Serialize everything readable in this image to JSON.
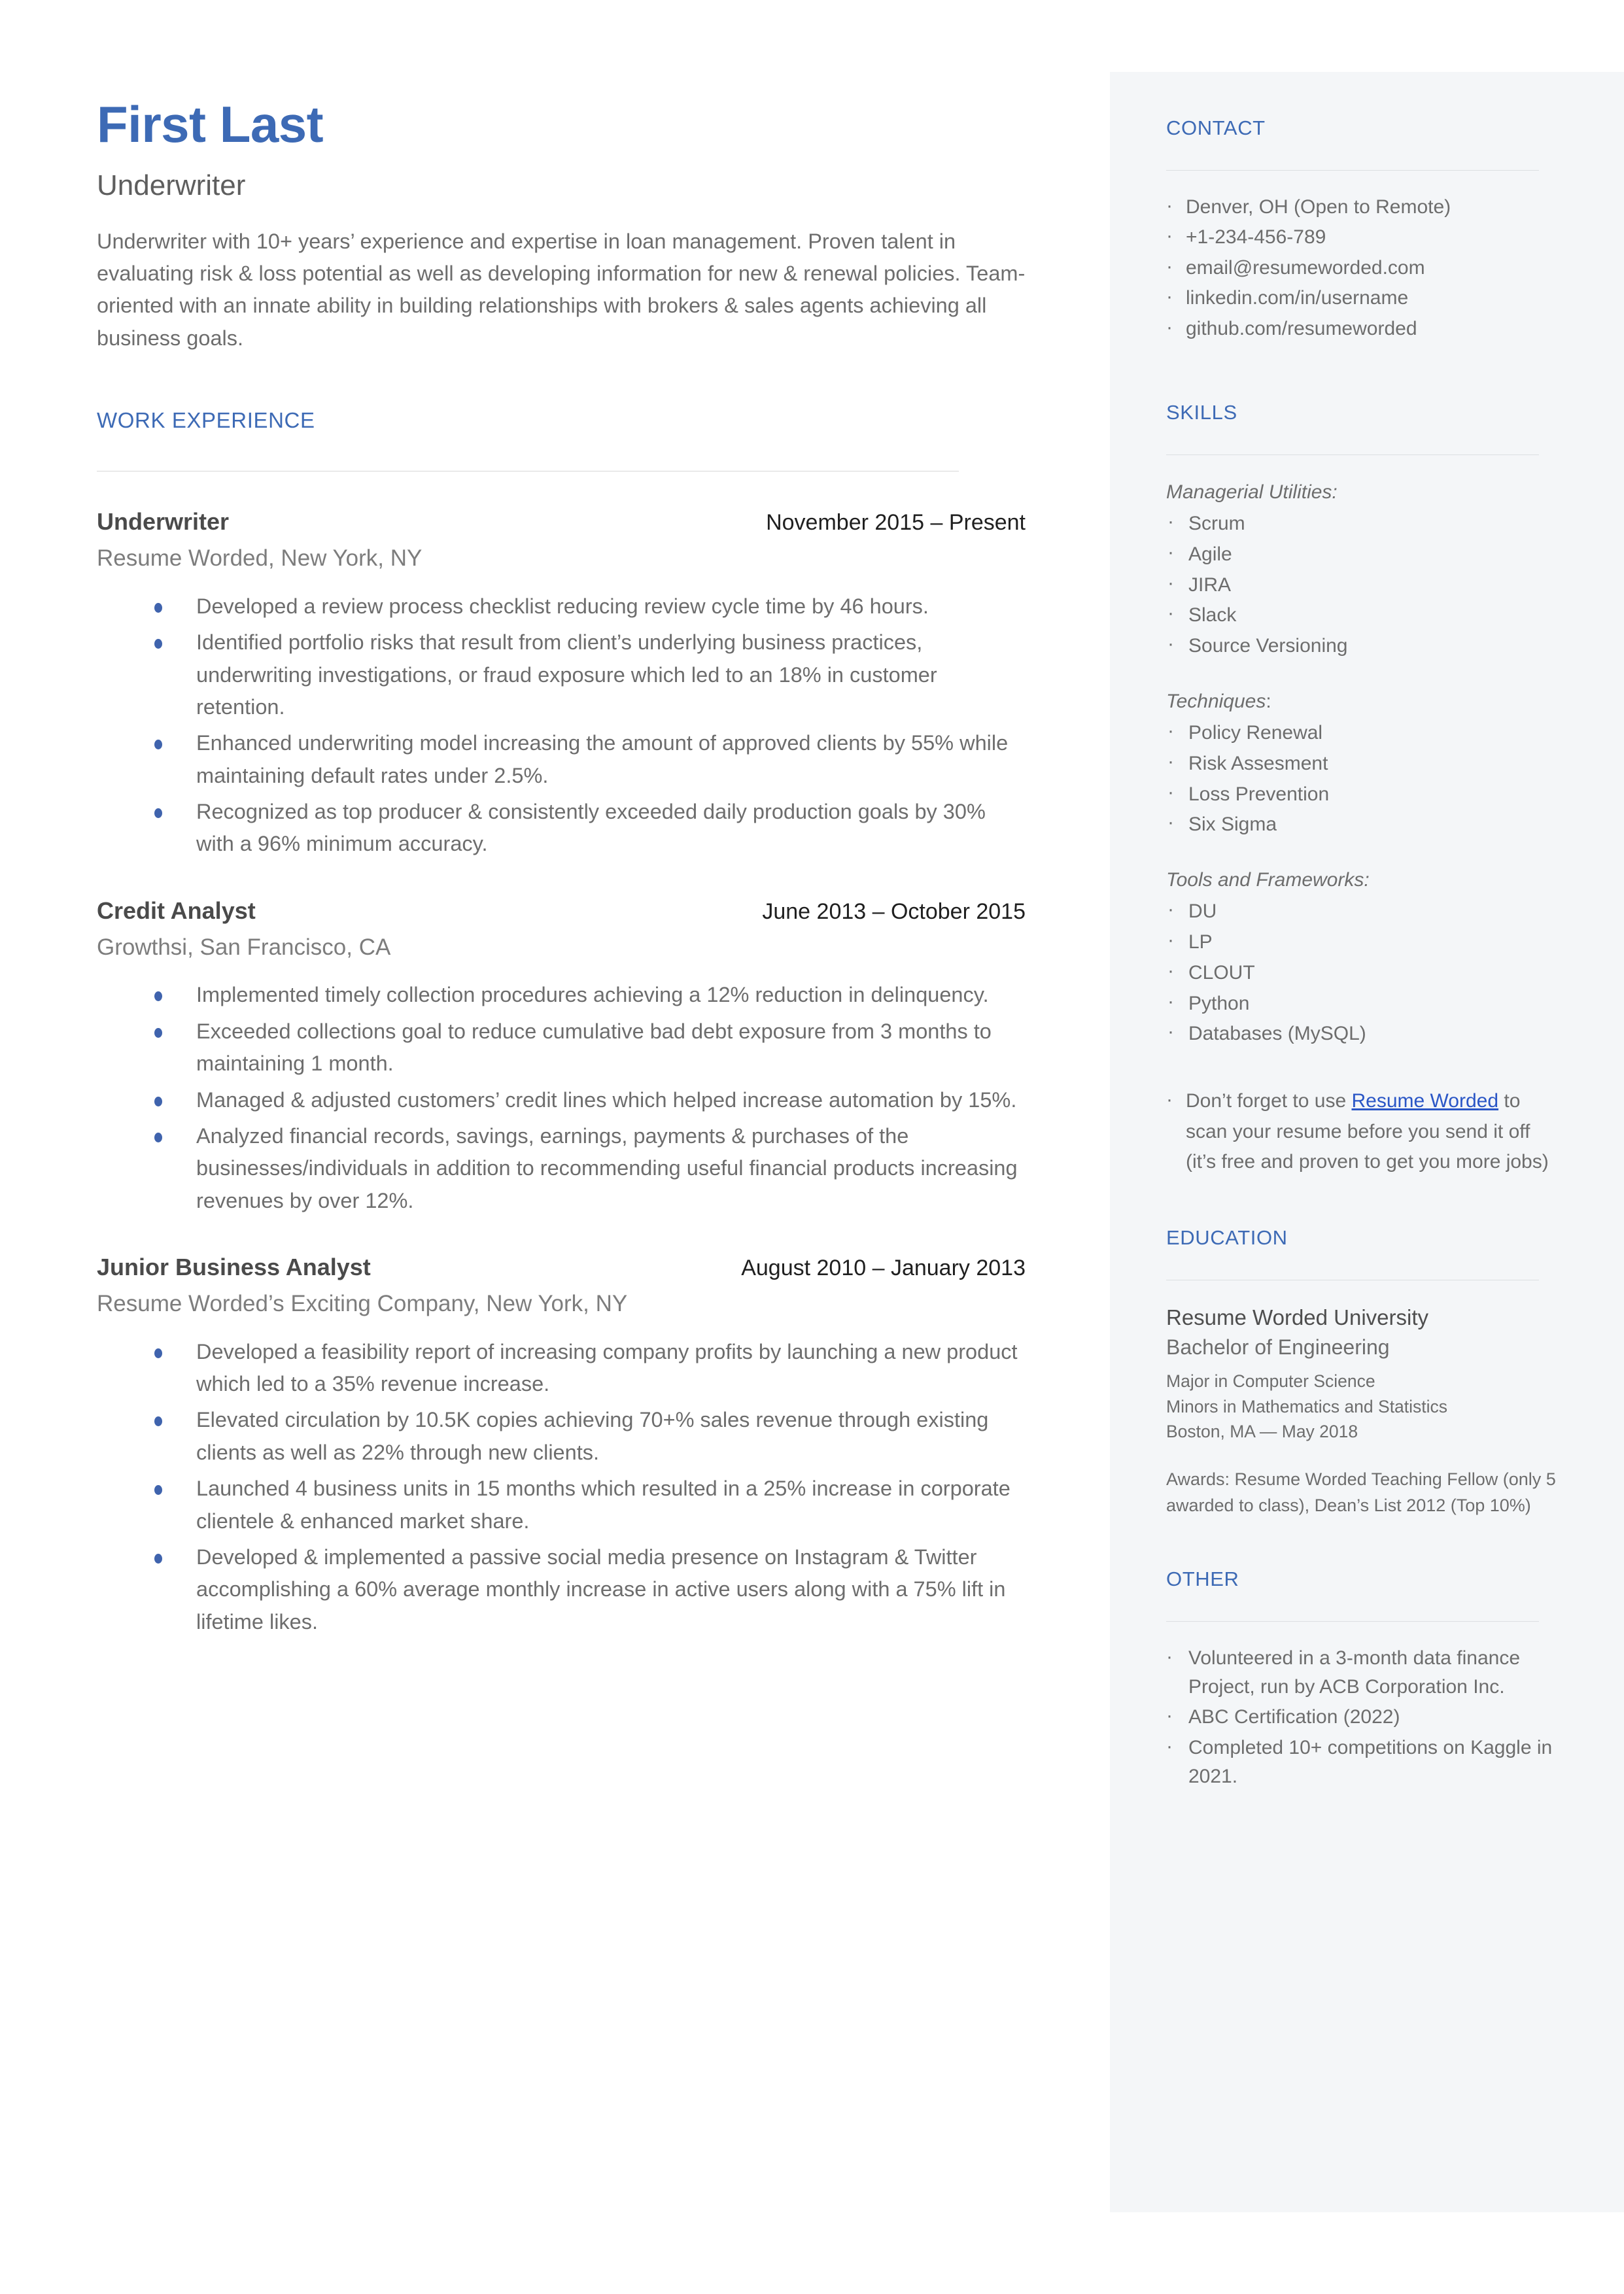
{
  "colors": {
    "accent": "#3d6ab5",
    "body_text": "#6d6d6d",
    "sidebar_bg": "#f4f6f8",
    "bullet": "#3f63ad",
    "link": "#2a56c6"
  },
  "header": {
    "name": "First Last",
    "title": "Underwriter",
    "summary": "Underwriter with 10+ years’ experience and expertise in loan management. Proven talent in evaluating risk & loss potential as well as developing information for new & renewal policies. Team-oriented with an innate ability in building relationships with brokers & sales agents achieving all business goals."
  },
  "work_experience": {
    "heading": "WORK EXPERIENCE",
    "jobs": [
      {
        "role": "Underwriter",
        "dates": "November 2015 – Present",
        "company": "Resume Worded, New York, NY",
        "bullets": [
          "Developed a review process checklist reducing review cycle time by 46 hours.",
          "Identified portfolio risks that result  from client’s underlying business practices, underwriting investigations, or fraud exposure which led to an 18% in customer retention.",
          "Enhanced underwriting model increasing the amount of approved clients by 55% while maintaining default rates under 2.5%.",
          "Recognized as top producer & consistently exceeded daily production goals by 30% with a 96% minimum accuracy."
        ]
      },
      {
        "role": "Credit Analyst",
        "dates": "June 2013 – October 2015",
        "company": "Growthsi, San Francisco, CA",
        "bullets": [
          "Implemented timely collection procedures achieving a 12% reduction in delinquency.",
          "Exceeded collections goal to reduce cumulative bad debt exposure from 3 months to maintaining 1 month.",
          "Managed & adjusted customers’ credit lines which helped increase automation by 15%.",
          "Analyzed financial records, savings, earnings, payments & purchases of the businesses/individuals in addition to recommending useful financial products increasing revenues by over 12%."
        ]
      },
      {
        "role": "Junior Business Analyst",
        "dates": "August 2010 – January 2013",
        "company": "Resume Worded’s Exciting Company, New York, NY",
        "bullets": [
          "Developed a feasibility report of increasing company profits by launching a new product which led to a 35% revenue increase.",
          "Elevated circulation by 10.5K copies achieving 70+% sales revenue through existing clients as well as 22% through new clients.",
          "Launched 4 business units in 15 months which resulted in a 25% increase in corporate clientele & enhanced market share.",
          "Developed & implemented a passive social media presence on Instagram & Twitter accomplishing a 60% average monthly increase in active users along with a 75% lift in lifetime likes."
        ]
      }
    ]
  },
  "sidebar": {
    "contact": {
      "heading": "CONTACT",
      "items": [
        " Denver, OH (Open to Remote)",
        "+1-234-456-789",
        "email@resumeworded.com",
        "linkedin.com/in/username",
        "github.com/resumeworded"
      ]
    },
    "skills": {
      "heading": "SKILLS",
      "groups": [
        {
          "label": "Managerial Utilities:",
          "label_italic": "Managerial Utilities:",
          "label_plain": "",
          "items": [
            "Scrum",
            "Agile",
            "JIRA",
            "Slack",
            "Source Versioning"
          ]
        },
        {
          "label": "Techniques:",
          "label_italic": "Techniques",
          "label_plain": ":",
          "items": [
            "Policy Renewal",
            "Risk Assesment",
            "Loss Prevention",
            "Six Sigma"
          ]
        },
        {
          "label": "Tools and Frameworks:",
          "label_italic": "Tools and Frameworks:",
          "label_plain": "",
          "items": [
            "DU",
            "LP",
            "CLOUT",
            "Python",
            "Databases (MySQL)"
          ]
        }
      ],
      "promo": {
        "before": "Don’t forget to use ",
        "link": "Resume Worded",
        "after": " to scan your resume before you send it off (it’s free and proven to get you more jobs)"
      }
    },
    "education": {
      "heading": "EDUCATION",
      "school": "Resume Worded University",
      "degree": "Bachelor of Engineering",
      "major": "Major in Computer Science",
      "minors": "Minors in Mathematics and Statistics",
      "location_date": "Boston, MA — May 2018",
      "awards": "Awards: Resume Worded Teaching Fellow (only 5 awarded to class), Dean’s List 2012 (Top 10%)"
    },
    "other": {
      "heading": "OTHER",
      "items": [
        " Volunteered in a 3-month data finance Project, run by ACB Corporation Inc.",
        " ABC Certification (2022)",
        " Completed 10+ competitions on Kaggle in 2021."
      ]
    }
  }
}
